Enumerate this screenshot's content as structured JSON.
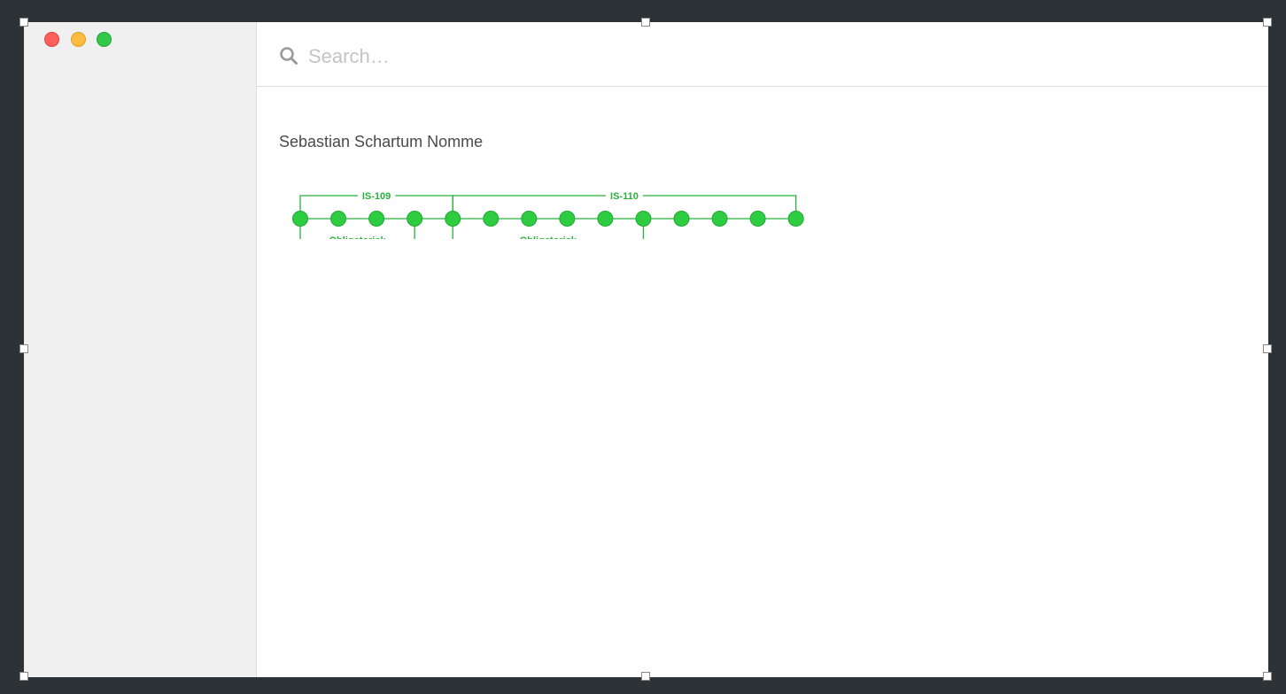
{
  "window": {
    "traffic_lights": {
      "close_color": "#fc605c",
      "minimize_color": "#fdbc40",
      "maximize_color": "#34c84a"
    }
  },
  "search": {
    "placeholder": "Search…",
    "value": "",
    "icon": "search-icon"
  },
  "person": {
    "name": "Sebastian Schartum Nomme"
  },
  "timeline": {
    "accent_color": "#28b13c",
    "node_fill": "#2ecc40",
    "node_count": 14,
    "top_brackets": [
      {
        "label": "IS-109",
        "from_node": 0,
        "to_node": 4
      },
      {
        "label": "IS-110",
        "from_node": 4,
        "to_node": 13
      }
    ],
    "bottom_brackets": [
      {
        "label": "Obligatorisk",
        "from_node": 0,
        "to_node": 3
      },
      {
        "label": "Obligatorisk",
        "from_node": 4,
        "to_node": 9
      }
    ]
  }
}
